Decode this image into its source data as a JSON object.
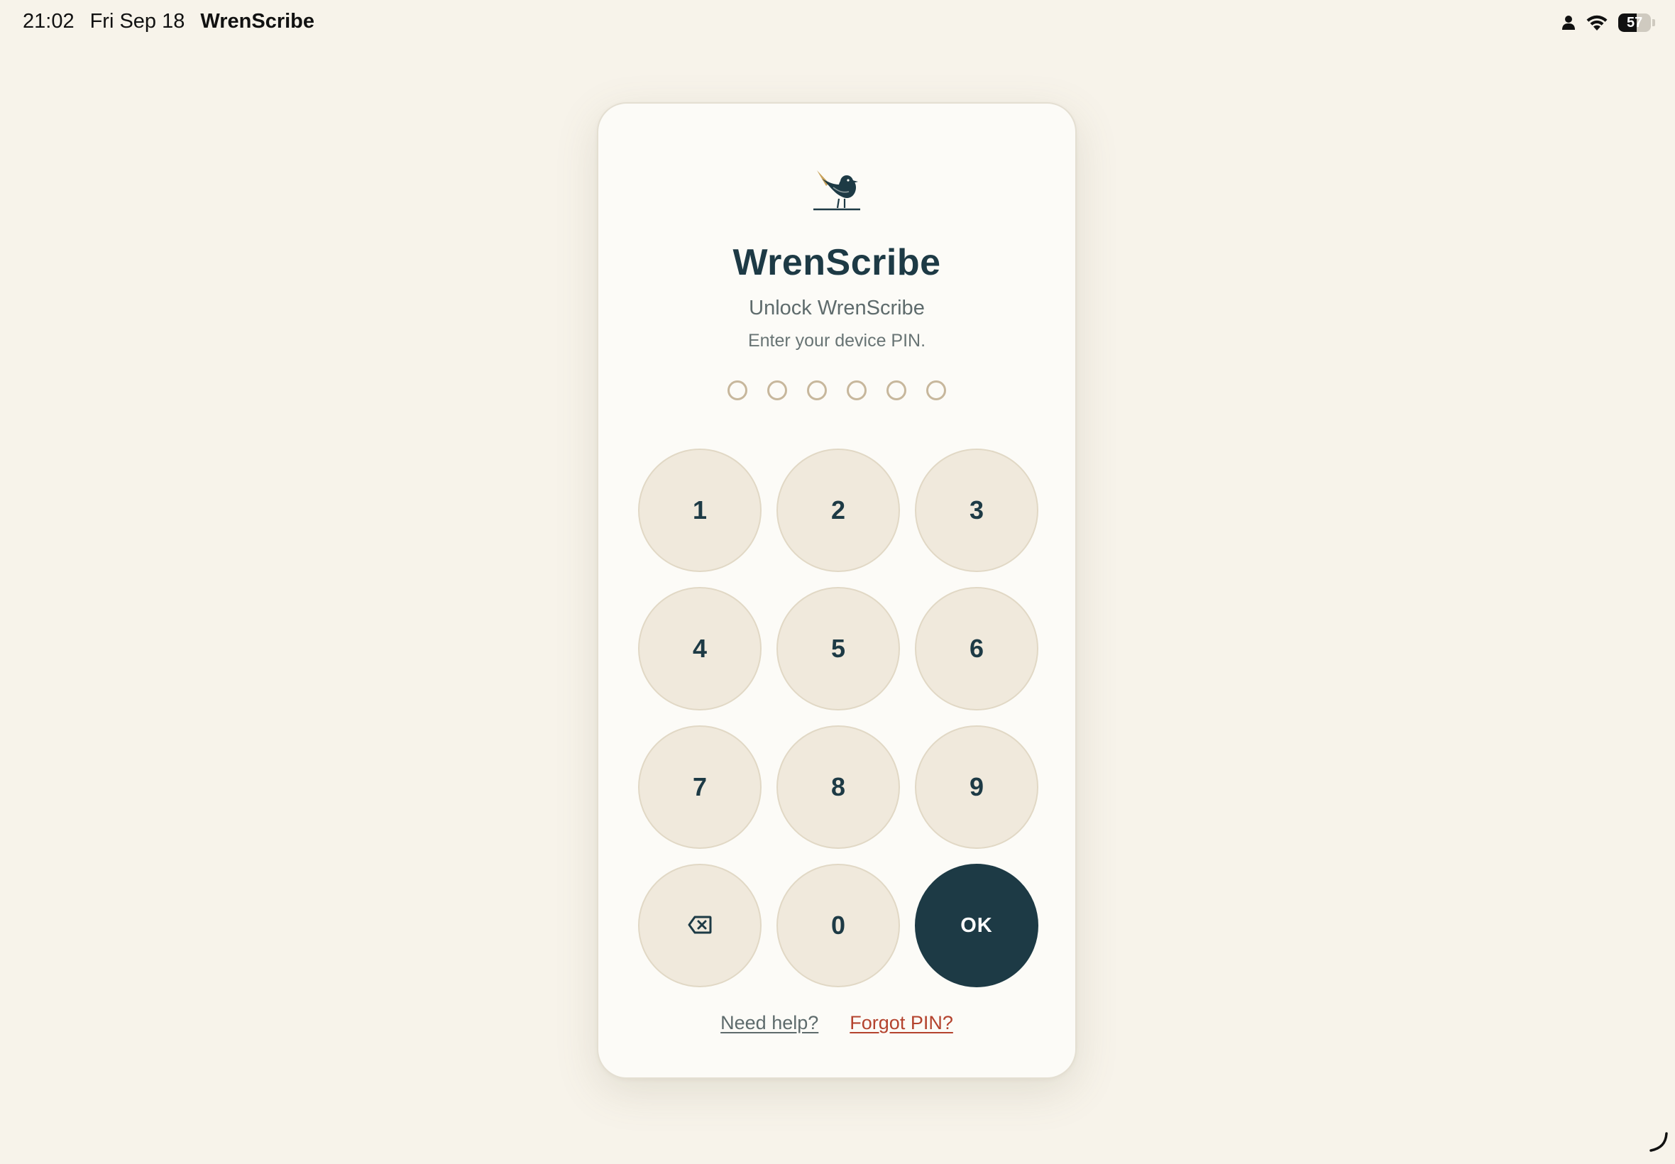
{
  "status_bar": {
    "time": "21:02",
    "date": "Fri Sep 18",
    "app_name": "WrenScribe",
    "battery_percent": "57",
    "battery_level": 0.57,
    "icons": [
      "person-icon",
      "wifi-icon",
      "battery-icon"
    ]
  },
  "lock_screen": {
    "logo_icon": "wren-bird-icon",
    "title": "WrenScribe",
    "subtitle": "Unlock WrenScribe",
    "hint": "Enter your device PIN.",
    "pin_length": 6,
    "pin_entered": 0,
    "keys": {
      "k1": "1",
      "k2": "2",
      "k3": "3",
      "k4": "4",
      "k5": "5",
      "k6": "6",
      "k7": "7",
      "k8": "8",
      "k9": "9",
      "backspace_icon": "backspace-icon",
      "k0": "0",
      "ok": "OK"
    },
    "links": {
      "help": "Need help?",
      "forgot": "Forgot PIN?"
    }
  },
  "colors": {
    "background": "#f7f3ea",
    "card": "#fcfbf7",
    "key": "#f0e9dc",
    "primary": "#1d3a45",
    "danger_link": "#b4432e",
    "pin_dot": "#c7b79c"
  }
}
